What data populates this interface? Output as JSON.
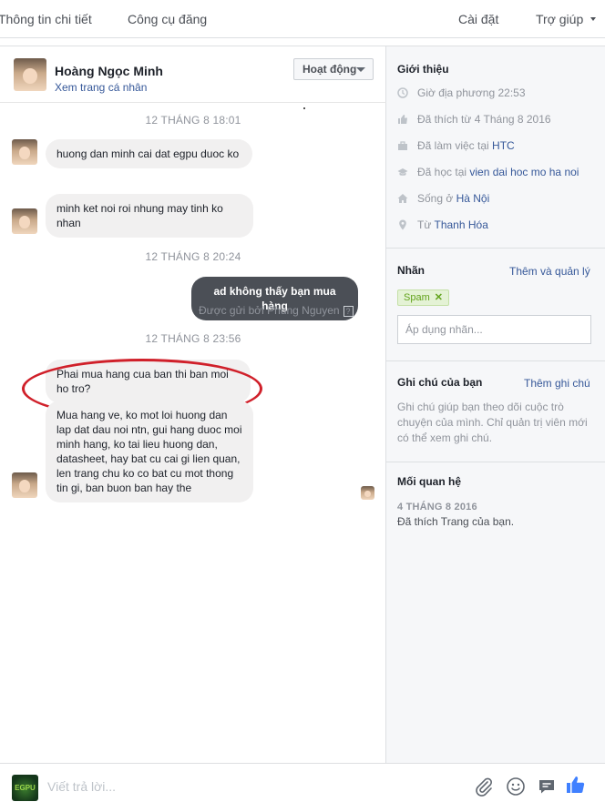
{
  "topnav": {
    "details": "Thông tin chi tiết",
    "publishing_tools": "Công cụ đăng",
    "settings": "Cài đặt",
    "help": "Trợ giúp"
  },
  "conversation": {
    "contact_name": "Hoàng Ngọc Minh",
    "profile_link": "Xem trang cá nhân",
    "status_button": "Hoạt động",
    "messages": [
      {
        "type": "timestamp",
        "text": "12 THÁNG 8 18:01"
      },
      {
        "type": "incoming",
        "text": "huong dan minh cai dat egpu duoc ko"
      },
      {
        "type": "incoming",
        "text": "minh ket noi roi nhung may tinh ko nhan"
      },
      {
        "type": "timestamp",
        "text": "12 THÁNG 8 20:24"
      },
      {
        "type": "outgoing",
        "text": "ad không thấy bạn mua hàng"
      },
      {
        "type": "timestamp",
        "text": "12 THÁNG 8 23:56"
      },
      {
        "type": "incoming",
        "text": "Phai mua hang cua ban thi ban moi ho tro?"
      },
      {
        "type": "incoming",
        "text": "Mua hang ve, ko mot loi huong dan lap dat dau noi ntn, gui hang duoc moi minh hang, ko tai lieu huong dan, datasheet, hay bat cu cai gi lien quan, len trang chu ko co bat cu mot thong tin gi, ban buon ban hay the"
      }
    ],
    "sent_by": "Được gửi bởi Phung Nguyen",
    "sent_by_help": "?"
  },
  "reply": {
    "placeholder": "Viết trả lời...",
    "page_logo_text": "EGPU"
  },
  "info": {
    "intro_title": "Giới thiệu",
    "local_time_label": "Giờ địa phương",
    "local_time": "22:53",
    "liked_since": "Đã thích từ 4 Tháng 8 2016",
    "work_prefix": "Đã làm việc tại",
    "work_place": "HTC",
    "study_prefix": "Đã học tại",
    "study_place": "vien dai hoc mo ha noi",
    "lives_prefix": "Sống ở",
    "lives_place": "Hà Nội",
    "from_prefix": "Từ",
    "from_place": "Thanh Hóa",
    "labels_title": "Nhãn",
    "labels_action": "Thêm và quản lý",
    "tag": "Spam",
    "tag_input_placeholder": "Áp dụng nhãn...",
    "notes_title": "Ghi chú của bạn",
    "notes_action": "Thêm ghi chú",
    "notes_text": "Ghi chú giúp bạn theo dõi cuộc trò chuyện của mình. Chỉ quản trị viên mới có thể xem ghi chú.",
    "relationship_title": "Mối quan hệ",
    "relationship_date": "4 THÁNG 8 2016",
    "relationship_text": "Đã thích Trang của bạn."
  },
  "colors": {
    "link": "#365899",
    "outgoing_bubble": "#4b4f56",
    "incoming_bubble": "#f1f0f0",
    "annotation_ellipse": "#d0202a",
    "like_blue": "#4080ff",
    "spam_tag": "#62a31c"
  },
  "icons": [
    "clock-icon",
    "thumbs-up-icon",
    "briefcase-icon",
    "graduation-cap-icon",
    "home-icon",
    "location-pin-icon",
    "paperclip-icon",
    "emoji-icon",
    "saved-reply-icon",
    "like-icon"
  ]
}
